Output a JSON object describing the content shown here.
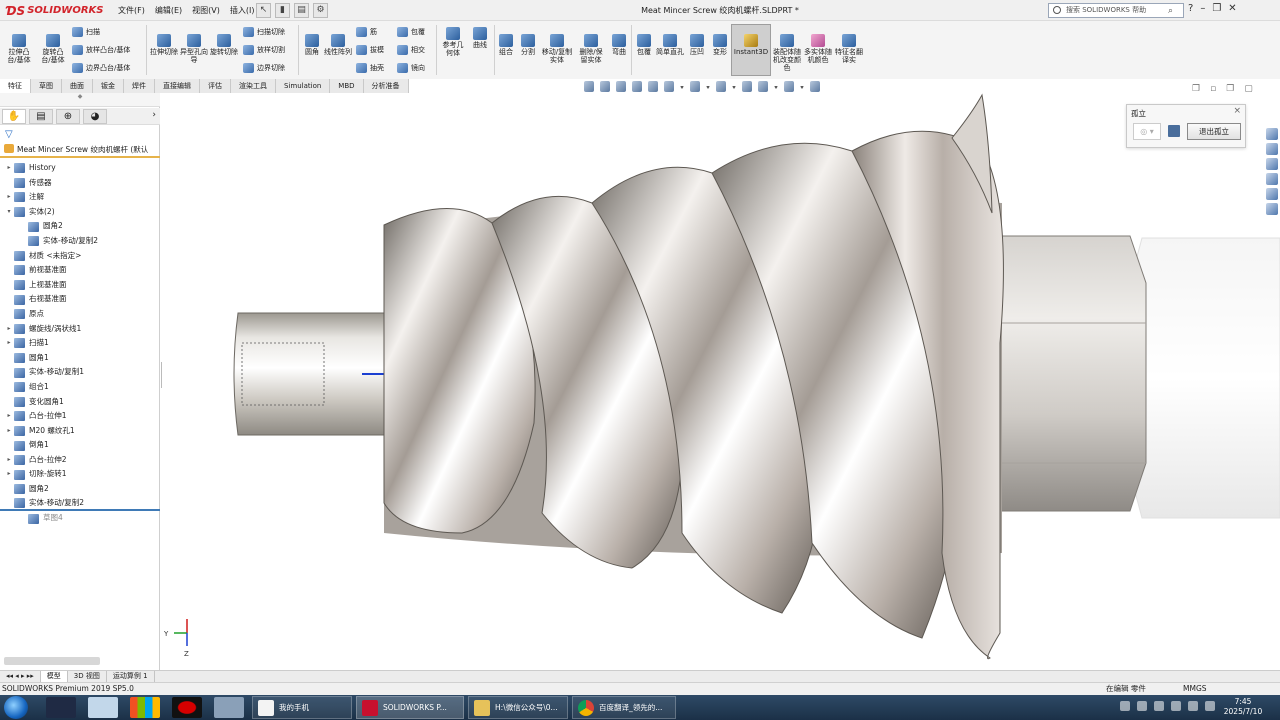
{
  "app": {
    "logo_text": "SOLIDWORKS",
    "doc_title": "Meat Mincer Screw 绞肉机螺杆.SLDPRT *",
    "menus": [
      "文件(F)",
      "编辑(E)",
      "视图(V)",
      "插入(I)"
    ],
    "search_placeholder": "搜索 SOLIDWORKS 帮助"
  },
  "ribbon": {
    "extrude_boss": "拉伸凸台/基体",
    "revolve_boss": "旋转凸台/基体",
    "sweep": "扫描",
    "loft_boss": "放样凸台/基体",
    "boundary_boss": "边界凸台/基体",
    "extrude_cut": "拉伸切除",
    "hole_wizard": "异型孔向导",
    "revolve_cut": "旋转切除",
    "sweep_cut": "扫描切除",
    "loft_cut": "放样切割",
    "boundary_cut": "边界切除",
    "fillet": "圆角",
    "linear_pattern": "线性阵列",
    "rib": "筋",
    "draft": "拔模",
    "shell": "抽壳",
    "wrap": "包覆",
    "intersect": "相交",
    "mirror": "镜向",
    "ref_geometry": "参考几何体",
    "curves": "曲线",
    "combine": "组合",
    "split": "分割",
    "move_copy": "移动/复制实体",
    "delete_keep": "删除/保留实体",
    "flex": "弯曲",
    "wrap2": "包覆",
    "simple_hole": "简单直孔",
    "indent": "压凹",
    "deform": "变形",
    "instant3d": "Instant3D",
    "assembly_color": "装配体随机改变颜色",
    "multibody_color": "多实体随机颜色",
    "feature_translate": "特征名翻译实"
  },
  "tabs": [
    "特征",
    "草图",
    "曲面",
    "钣金",
    "焊件",
    "直接编辑",
    "评估",
    "渲染工具",
    "Simulation",
    "MBD",
    "分析准备"
  ],
  "tree": {
    "root": "Meat Mincer Screw 绞肉机螺杆 (默认",
    "items": [
      {
        "label": "History",
        "exp": "▸",
        "indent": 0
      },
      {
        "label": "传感器",
        "exp": "",
        "indent": 0
      },
      {
        "label": "注解",
        "exp": "▸",
        "indent": 0
      },
      {
        "label": "实体(2)",
        "exp": "▾",
        "indent": 0
      },
      {
        "label": "圆角2",
        "exp": "",
        "indent": 1
      },
      {
        "label": "实体-移动/复制2",
        "exp": "",
        "indent": 1
      },
      {
        "label": "材质 <未指定>",
        "exp": "",
        "indent": 0
      },
      {
        "label": "前视基准面",
        "exp": "",
        "indent": 0
      },
      {
        "label": "上视基准面",
        "exp": "",
        "indent": 0
      },
      {
        "label": "右视基准面",
        "exp": "",
        "indent": 0
      },
      {
        "label": "原点",
        "exp": "",
        "indent": 0
      },
      {
        "label": "螺旋线/涡状线1",
        "exp": "▸",
        "indent": 0
      },
      {
        "label": "扫描1",
        "exp": "▸",
        "indent": 0
      },
      {
        "label": "圆角1",
        "exp": "",
        "indent": 0
      },
      {
        "label": "实体-移动/复制1",
        "exp": "",
        "indent": 0
      },
      {
        "label": "组合1",
        "exp": "",
        "indent": 0
      },
      {
        "label": "变化圆角1",
        "exp": "",
        "indent": 0
      },
      {
        "label": "凸台-拉伸1",
        "exp": "▸",
        "indent": 0
      },
      {
        "label": "M20 螺纹孔1",
        "exp": "▸",
        "indent": 0
      },
      {
        "label": "倒角1",
        "exp": "",
        "indent": 0
      },
      {
        "label": "凸台-拉伸2",
        "exp": "▸",
        "indent": 0
      },
      {
        "label": "切除-旋转1",
        "exp": "▸",
        "indent": 0
      },
      {
        "label": "圆角2",
        "exp": "",
        "indent": 0
      },
      {
        "label": "实体-移动/复制2",
        "exp": "",
        "indent": 0
      },
      {
        "label": "草图4",
        "exp": "",
        "indent": 1
      }
    ]
  },
  "isolate": {
    "title": "孤立",
    "exit_label": "退出孤立"
  },
  "bottom_tabs": [
    "模型",
    "3D 视图",
    "运动算例 1"
  ],
  "status": {
    "left": "SOLIDWORKS Premium 2019 SP5.0",
    "mode": "在编辑 零件",
    "units": "MMGS"
  },
  "taskbar": {
    "apps": [
      "我的手机",
      "SOLIDWORKS P...",
      "H:\\微信公众号\\0...",
      "百度翻译_领先的..."
    ],
    "time": "7:45",
    "date": "2025/7/10"
  },
  "triad": {
    "y_label": "Y",
    "z_label": "Z"
  }
}
